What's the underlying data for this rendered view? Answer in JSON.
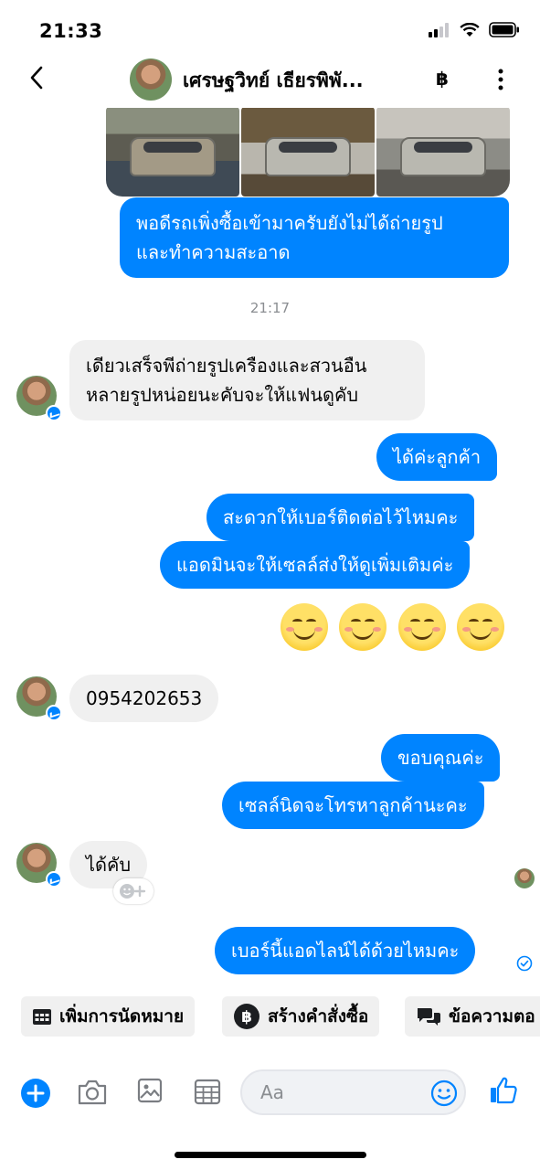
{
  "status": {
    "time": "21:33"
  },
  "header": {
    "name": "เศรษฐวิทย์ เธียรพิพั...",
    "icons": [
      "back-icon",
      "baht-icon",
      "more-icon"
    ]
  },
  "messages": {
    "m1": [
      "พอดีรถเพิ่งซื้อเข้ามาครับยังไม่ได้ถ่ายรูป",
      "และทำความสะอาด"
    ],
    "timestamp": "21:17",
    "m2": [
      "เดียวเสร็จพีถ่ายรูปเครืองและสวนอืน",
      "หลายรูปหน่อยนะคับจะให้แฟนดูคับ"
    ],
    "m3": "ได้ค่ะลูกค้า",
    "m4": "สะดวกให้เบอร์ติดต่อไว้ไหมคะ",
    "m5": "แอดมินจะให้เซลล์ส่งให้ดูเพิ่มเติมค่ะ",
    "emoji_count": 4,
    "m6": "0954202653",
    "m7": "ขอบคุณค่ะ",
    "m8": "เซลล์นิดจะโทรหาลูกค้านะคะ",
    "m9": "ได้คับ",
    "m10": "เบอร์นี้แอดไลน์ได้ด้วยไหมคะ"
  },
  "quick_actions": [
    "เพิ่มการนัดหมาย",
    "สร้างคำสั่งซื้อ",
    "ข้อความตอ"
  ],
  "composer": {
    "placeholder": "Aa"
  },
  "colors": {
    "accent": "#0084ff",
    "incoming": "#f0f0f0"
  }
}
